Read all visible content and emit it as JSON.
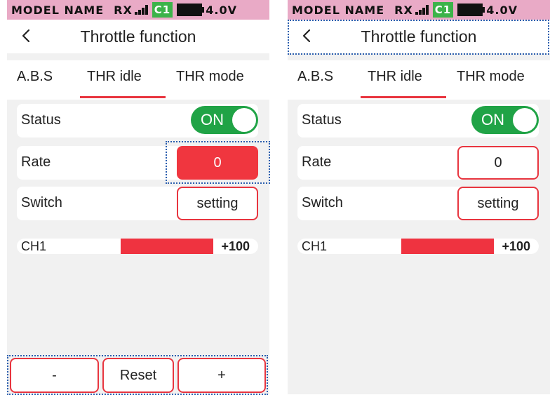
{
  "status_bar": {
    "model": "MODEL NAME",
    "rx": "RX",
    "channel_badge": "C1",
    "voltage": "4.0V",
    "accent": "#e9aac6"
  },
  "screens": [
    {
      "title": "Throttle function",
      "tabs": [
        "A.B.S",
        "THR idle",
        "THR mode"
      ],
      "active_tab": "THR idle",
      "status": {
        "label": "Status",
        "toggle": "ON"
      },
      "rate": {
        "label": "Rate",
        "value": "0"
      },
      "switch": {
        "label": "Switch",
        "button": "setting"
      },
      "channel": {
        "label": "CH1",
        "value": "+100"
      },
      "buttons": {
        "minus": "-",
        "reset": "Reset",
        "plus": "+"
      }
    },
    {
      "title": "Throttle function",
      "tabs": [
        "A.B.S",
        "THR idle",
        "THR mode"
      ],
      "active_tab": "THR idle",
      "status": {
        "label": "Status",
        "toggle": "ON"
      },
      "rate": {
        "label": "Rate",
        "value": "0"
      },
      "switch": {
        "label": "Switch",
        "button": "setting"
      },
      "channel": {
        "label": "CH1",
        "value": "+100"
      }
    }
  ],
  "colors": {
    "accent_red": "#e8353f",
    "toggle_green": "#20a346",
    "battery": "#111111"
  }
}
